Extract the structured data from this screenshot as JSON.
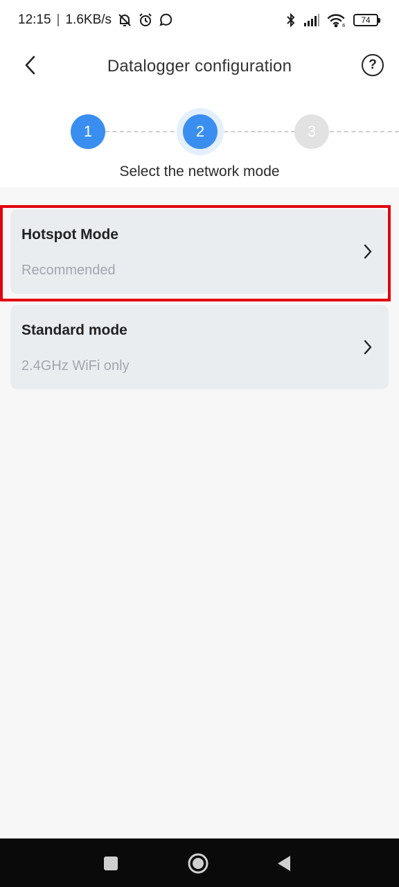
{
  "status_bar": {
    "time": "12:15",
    "separator": "|",
    "speed": "1.6KB/s",
    "battery": "74",
    "icons": [
      "muted-bell-icon",
      "alarm-icon",
      "whatsapp-icon",
      "bluetooth-icon",
      "signal-icon",
      "wifi-icon",
      "battery-icon"
    ]
  },
  "header": {
    "title": "Datalogger configuration",
    "back_icon": "chevron-left-icon",
    "help_label": "?"
  },
  "stepper": {
    "steps": [
      {
        "label": "1",
        "state": "done"
      },
      {
        "label": "2",
        "state": "current"
      },
      {
        "label": "3",
        "state": "todo"
      }
    ],
    "caption": "Select the network mode",
    "accent": "#3a8ef0"
  },
  "modes": [
    {
      "title": "Hotspot Mode",
      "subtitle": "Recommended",
      "highlighted": true
    },
    {
      "title": "Standard mode",
      "subtitle": "2.4GHz WiFi only",
      "highlighted": false
    }
  ],
  "colors": {
    "highlight": "#e3000f",
    "card_bg": "#eaedf0"
  },
  "nav_bar": {
    "icons": [
      "recents-square-icon",
      "home-circle-icon",
      "back-triangle-icon"
    ]
  }
}
